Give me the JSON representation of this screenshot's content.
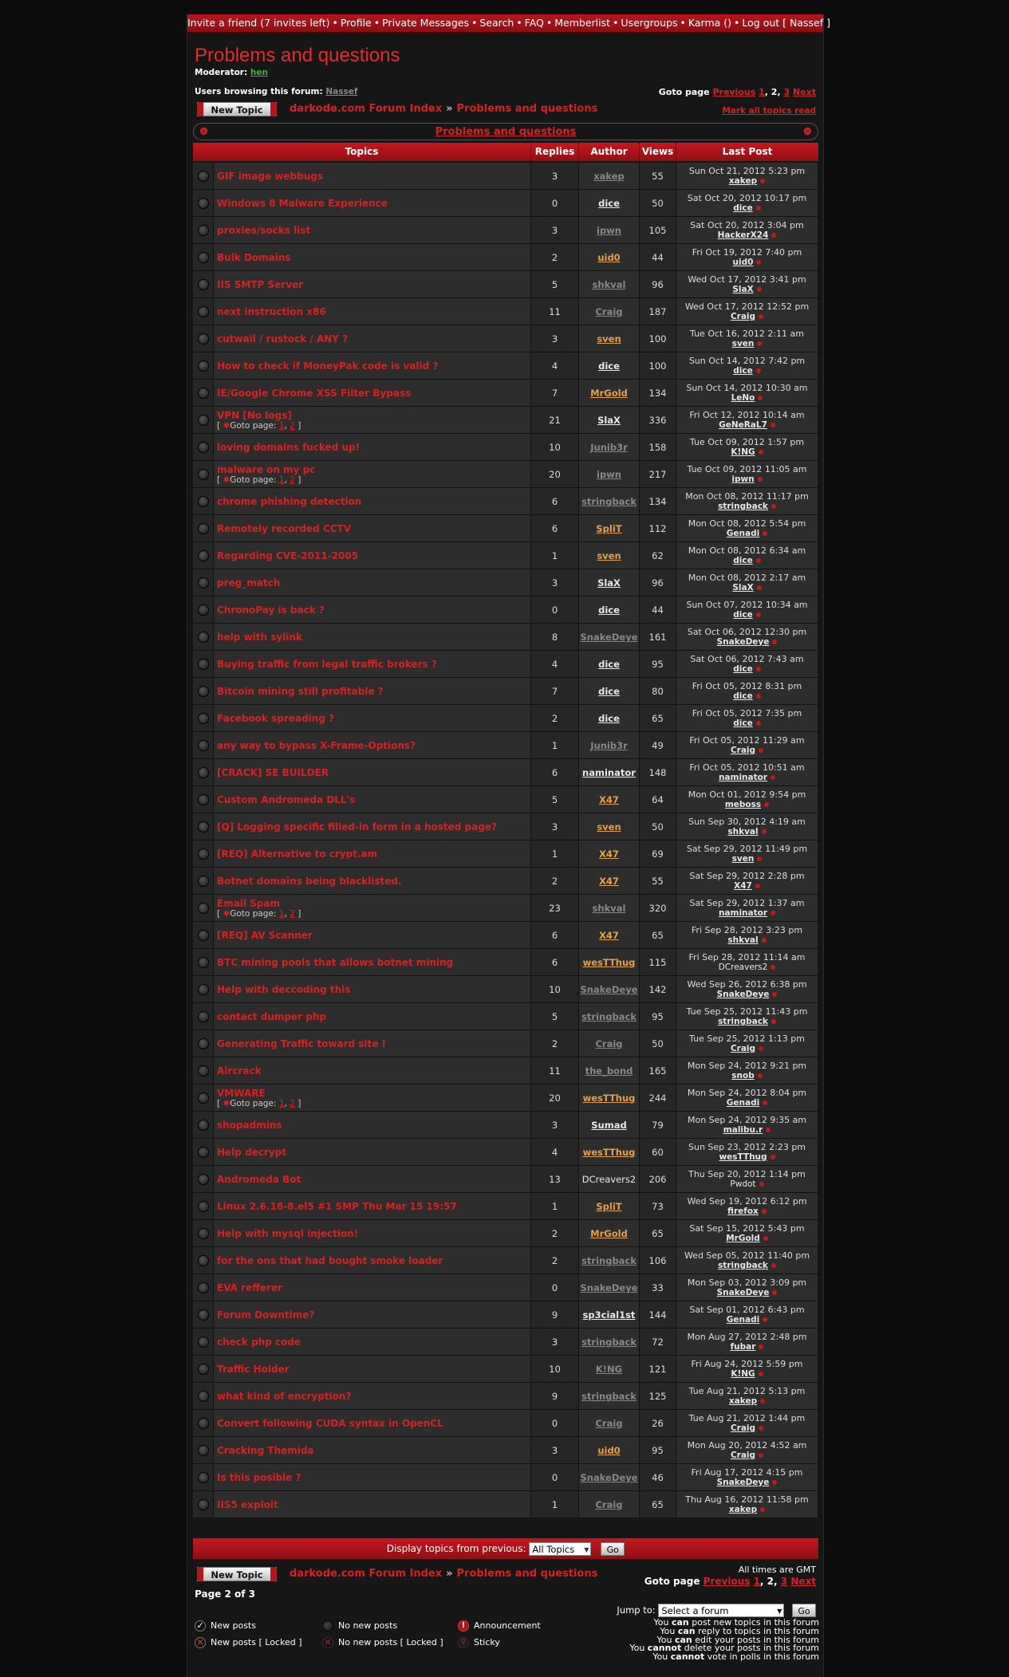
{
  "nav": {
    "items": [
      "Invite a friend (7 invites left)",
      "Profile",
      "Private Messages",
      "Search",
      "FAQ",
      "Memberlist",
      "Usergroups",
      "Karma ()",
      "Log out [ Nassef ]"
    ]
  },
  "forum": {
    "title": "Problems and questions",
    "moderator_label": "Moderator:",
    "moderator": "hen",
    "browsing_label": "Users browsing this forum:",
    "browsing_user": "Nassef",
    "mark_all": "Mark all topics read",
    "new_topic": "New Topic",
    "crumb_index": "darkode.com Forum Index",
    "crumb_sep": "»",
    "crumb_forum": "Problems and questions",
    "category_title": "Problems and questions"
  },
  "pagination": {
    "label": "Goto page",
    "previous": "Previous",
    "p1": "1",
    "p2": "2",
    "p3": "3",
    "next": "Next",
    "page_of": "Page 2 of 3"
  },
  "table": {
    "headers": [
      "Topics",
      "Replies",
      "Author",
      "Views",
      "Last Post"
    ]
  },
  "topics": [
    {
      "title": "GIF image webbugs",
      "replies": "3",
      "author": "xakep",
      "author_style": "gray",
      "views": "55",
      "last_date": "Sun Oct 21, 2012 5:23 pm",
      "last_user": "xakep",
      "last_style": "white"
    },
    {
      "title": "Windows 8 Malware Experience",
      "replies": "0",
      "author": "dice",
      "author_style": "white",
      "views": "50",
      "last_date": "Sat Oct 20, 2012 10:17 pm",
      "last_user": "dice",
      "last_style": "white"
    },
    {
      "title": "proxies/socks list",
      "replies": "3",
      "author": "ipwn",
      "author_style": "gray",
      "views": "105",
      "last_date": "Sat Oct 20, 2012 3:04 pm",
      "last_user": "HackerX24",
      "last_style": "white"
    },
    {
      "title": "Bulk Domains",
      "replies": "2",
      "author": "uid0",
      "author_style": "orange",
      "views": "44",
      "last_date": "Fri Oct 19, 2012 7:40 pm",
      "last_user": "uid0",
      "last_style": "white"
    },
    {
      "title": "IIS SMTP Server",
      "replies": "5",
      "author": "shkval",
      "author_style": "gray",
      "views": "96",
      "last_date": "Wed Oct 17, 2012 3:41 pm",
      "last_user": "SlaX",
      "last_style": "white"
    },
    {
      "title": "next instruction x86",
      "replies": "11",
      "author": "Craig",
      "author_style": "gray",
      "views": "187",
      "last_date": "Wed Oct 17, 2012 12:52 pm",
      "last_user": "Craig",
      "last_style": "white"
    },
    {
      "title": "cutwail / rustock / ANY ?",
      "replies": "3",
      "author": "sven",
      "author_style": "orange",
      "views": "100",
      "last_date": "Tue Oct 16, 2012 2:11 am",
      "last_user": "sven",
      "last_style": "white"
    },
    {
      "title": "How to check if MoneyPak code is valid ?",
      "replies": "4",
      "author": "dice",
      "author_style": "white",
      "views": "100",
      "last_date": "Sun Oct 14, 2012 7:42 pm",
      "last_user": "dice",
      "last_style": "white"
    },
    {
      "title": "IE/Google Chrome XSS Filter Bypass",
      "replies": "7",
      "author": "MrGold",
      "author_style": "orange",
      "views": "134",
      "last_date": "Sun Oct 14, 2012 10:30 am",
      "last_user": "LeNo",
      "last_style": "white"
    },
    {
      "title": "VPN [No logs]",
      "pages": true,
      "replies": "21",
      "author": "SlaX",
      "author_style": "white",
      "views": "336",
      "last_date": "Fri Oct 12, 2012 10:14 am",
      "last_user": "GeNeRaL7",
      "last_style": "white"
    },
    {
      "title": "loving domains fucked up!",
      "replies": "10",
      "author": "Junib3r",
      "author_style": "gray",
      "views": "158",
      "last_date": "Tue Oct 09, 2012 1:57 pm",
      "last_user": "K!NG",
      "last_style": "white"
    },
    {
      "title": "malware on my pc",
      "pages": true,
      "replies": "20",
      "author": "ipwn",
      "author_style": "gray",
      "views": "217",
      "last_date": "Tue Oct 09, 2012 11:05 am",
      "last_user": "ipwn",
      "last_style": "white"
    },
    {
      "title": "chrome phishing detection",
      "replies": "6",
      "author": "stringback",
      "author_style": "gray",
      "views": "134",
      "last_date": "Mon Oct 08, 2012 11:17 pm",
      "last_user": "stringback",
      "last_style": "white"
    },
    {
      "title": "Remotely recorded CCTV",
      "replies": "6",
      "author": "SpliT",
      "author_style": "orange",
      "views": "112",
      "last_date": "Mon Oct 08, 2012 5:54 pm",
      "last_user": "Genadi",
      "last_style": "white"
    },
    {
      "title": "Regarding CVE-2011-2005",
      "replies": "1",
      "author": "sven",
      "author_style": "orange",
      "views": "62",
      "last_date": "Mon Oct 08, 2012 6:34 am",
      "last_user": "dice",
      "last_style": "white"
    },
    {
      "title": "preg_match",
      "replies": "3",
      "author": "SlaX",
      "author_style": "white",
      "views": "96",
      "last_date": "Mon Oct 08, 2012 2:17 am",
      "last_user": "SlaX",
      "last_style": "white"
    },
    {
      "title": "ChronoPay is back ?",
      "replies": "0",
      "author": "dice",
      "author_style": "white",
      "views": "44",
      "last_date": "Sun Oct 07, 2012 10:34 am",
      "last_user": "dice",
      "last_style": "white"
    },
    {
      "title": "help with sylink",
      "replies": "8",
      "author": "SnakeDeye",
      "author_style": "gray",
      "views": "161",
      "last_date": "Sat Oct 06, 2012 12:30 pm",
      "last_user": "SnakeDeye",
      "last_style": "white"
    },
    {
      "title": "Buying traffic from legal traffic brokers ?",
      "replies": "4",
      "author": "dice",
      "author_style": "white",
      "views": "95",
      "last_date": "Sat Oct 06, 2012 7:43 am",
      "last_user": "dice",
      "last_style": "white"
    },
    {
      "title": "Bitcoin mining still profitable ?",
      "replies": "7",
      "author": "dice",
      "author_style": "white",
      "views": "80",
      "last_date": "Fri Oct 05, 2012 8:31 pm",
      "last_user": "dice",
      "last_style": "white"
    },
    {
      "title": "Facebook spreading ?",
      "replies": "2",
      "author": "dice",
      "author_style": "white",
      "views": "65",
      "last_date": "Fri Oct 05, 2012 7:35 pm",
      "last_user": "dice",
      "last_style": "white"
    },
    {
      "title": "any way to bypass X-Frame-Options?",
      "replies": "1",
      "author": "Junib3r",
      "author_style": "gray",
      "views": "49",
      "last_date": "Fri Oct 05, 2012 11:29 am",
      "last_user": "Craig",
      "last_style": "white"
    },
    {
      "title": "[CRACK] SE BUILDER",
      "replies": "6",
      "author": "naminator",
      "author_style": "white",
      "views": "148",
      "last_date": "Fri Oct 05, 2012 10:51 am",
      "last_user": "naminator",
      "last_style": "white"
    },
    {
      "title": "Custom Andromeda DLL's",
      "replies": "5",
      "author": "X47",
      "author_style": "orange",
      "views": "64",
      "last_date": "Mon Oct 01, 2012 9:54 pm",
      "last_user": "meboss",
      "last_style": "white"
    },
    {
      "title": "[Q] Logging specific filled-in form in a hosted page?",
      "replies": "3",
      "author": "sven",
      "author_style": "orange",
      "views": "50",
      "last_date": "Sun Sep 30, 2012 4:19 am",
      "last_user": "shkval",
      "last_style": "white"
    },
    {
      "title": "[REQ] Alternative to crypt.am",
      "replies": "1",
      "author": "X47",
      "author_style": "orange",
      "views": "69",
      "last_date": "Sat Sep 29, 2012 11:49 pm",
      "last_user": "sven",
      "last_style": "white"
    },
    {
      "title": "Botnet domains being blacklisted.",
      "replies": "2",
      "author": "X47",
      "author_style": "orange",
      "views": "55",
      "last_date": "Sat Sep 29, 2012 2:28 pm",
      "last_user": "X47",
      "last_style": "white"
    },
    {
      "title": "Email Spam",
      "pages": true,
      "replies": "23",
      "author": "shkval",
      "author_style": "gray",
      "views": "320",
      "last_date": "Sat Sep 29, 2012 1:37 am",
      "last_user": "naminator",
      "last_style": "white"
    },
    {
      "title": "[REQ] AV Scanner",
      "replies": "6",
      "author": "X47",
      "author_style": "orange",
      "views": "65",
      "last_date": "Fri Sep 28, 2012 3:23 pm",
      "last_user": "shkval",
      "last_style": "white"
    },
    {
      "title": "BTC mining pools that allows botnet mining",
      "replies": "6",
      "author": "wesTThug",
      "author_style": "orange",
      "views": "115",
      "last_date": "Fri Sep 28, 2012 11:14 am",
      "last_user": "DCreavers2",
      "last_style": "plain"
    },
    {
      "title": "Help with deccoding this",
      "replies": "10",
      "author": "SnakeDeye",
      "author_style": "gray",
      "views": "142",
      "last_date": "Wed Sep 26, 2012 6:38 pm",
      "last_user": "SnakeDeye",
      "last_style": "white"
    },
    {
      "title": "contact dumper php",
      "replies": "5",
      "author": "stringback",
      "author_style": "gray",
      "views": "95",
      "last_date": "Tue Sep 25, 2012 11:43 pm",
      "last_user": "stringback",
      "last_style": "white"
    },
    {
      "title": "Generating Traffic toward site !",
      "replies": "2",
      "author": "Craig",
      "author_style": "gray",
      "views": "50",
      "last_date": "Tue Sep 25, 2012 1:13 pm",
      "last_user": "Craig",
      "last_style": "white"
    },
    {
      "title": "Aircrack",
      "replies": "11",
      "author": "the_bond",
      "author_style": "gray",
      "views": "165",
      "last_date": "Mon Sep 24, 2012 9:21 pm",
      "last_user": "snob",
      "last_style": "white"
    },
    {
      "title": "VMWARE",
      "pages": true,
      "replies": "20",
      "author": "wesTThug",
      "author_style": "orange",
      "views": "244",
      "last_date": "Mon Sep 24, 2012 8:04 pm",
      "last_user": "Genadi",
      "last_style": "white"
    },
    {
      "title": "shopadmins",
      "replies": "3",
      "author": "Sumad",
      "author_style": "white",
      "views": "79",
      "last_date": "Mon Sep 24, 2012 9:35 am",
      "last_user": "malibu.r",
      "last_style": "white"
    },
    {
      "title": "Help decrypt",
      "replies": "4",
      "author": "wesTThug",
      "author_style": "orange",
      "views": "60",
      "last_date": "Sun Sep 23, 2012 2:23 pm",
      "last_user": "wesTThug",
      "last_style": "white"
    },
    {
      "title": "Andromeda Bot",
      "replies": "13",
      "author": "DCreavers2",
      "author_style": "plain",
      "views": "206",
      "last_date": "Thu Sep 20, 2012 1:14 pm",
      "last_user": "Pwdot",
      "last_style": "plain"
    },
    {
      "title": "Linux 2.6.18-8.el5 #1 SMP Thu Mar 15 19:57",
      "replies": "1",
      "author": "SpliT",
      "author_style": "orange",
      "views": "73",
      "last_date": "Wed Sep 19, 2012 6:12 pm",
      "last_user": "firefox",
      "last_style": "white"
    },
    {
      "title": "Help with mysql injection!",
      "replies": "2",
      "author": "MrGold",
      "author_style": "orange",
      "views": "65",
      "last_date": "Sat Sep 15, 2012 5:43 pm",
      "last_user": "MrGold",
      "last_style": "white"
    },
    {
      "title": "for the ons that had bought smoke loader",
      "replies": "2",
      "author": "stringback",
      "author_style": "gray",
      "views": "106",
      "last_date": "Wed Sep 05, 2012 11:40 pm",
      "last_user": "stringback",
      "last_style": "white"
    },
    {
      "title": "EVA refferer",
      "replies": "0",
      "author": "SnakeDeye",
      "author_style": "gray",
      "views": "33",
      "last_date": "Mon Sep 03, 2012 3:09 pm",
      "last_user": "SnakeDeye",
      "last_style": "white"
    },
    {
      "title": "Forum Downtime?",
      "replies": "9",
      "author": "sp3cial1st",
      "author_style": "white",
      "views": "144",
      "last_date": "Sat Sep 01, 2012 6:43 pm",
      "last_user": "Genadi",
      "last_style": "white"
    },
    {
      "title": "check php code",
      "replies": "3",
      "author": "stringback",
      "author_style": "gray",
      "views": "72",
      "last_date": "Mon Aug 27, 2012 2:48 pm",
      "last_user": "fubar",
      "last_style": "white"
    },
    {
      "title": "Traffic Holder",
      "replies": "10",
      "author": "K!NG",
      "author_style": "gray",
      "views": "121",
      "last_date": "Fri Aug 24, 2012 5:59 pm",
      "last_user": "K!NG",
      "last_style": "white"
    },
    {
      "title": "what kind of encryption?",
      "replies": "9",
      "author": "stringback",
      "author_style": "gray",
      "views": "125",
      "last_date": "Tue Aug 21, 2012 5:13 pm",
      "last_user": "xakep",
      "last_style": "white"
    },
    {
      "title": "Convert following CUDA syntax in OpenCL",
      "replies": "0",
      "author": "Craig",
      "author_style": "gray",
      "views": "26",
      "last_date": "Tue Aug 21, 2012 1:44 pm",
      "last_user": "Craig",
      "last_style": "white"
    },
    {
      "title": "Cracking Themida",
      "replies": "3",
      "author": "uid0",
      "author_style": "orange",
      "views": "95",
      "last_date": "Mon Aug 20, 2012 4:52 am",
      "last_user": "Craig",
      "last_style": "white"
    },
    {
      "title": "Is this posible ?",
      "replies": "0",
      "author": "SnakeDeye",
      "author_style": "gray",
      "views": "46",
      "last_date": "Fri Aug 17, 2012 4:15 pm",
      "last_user": "SnakeDeye",
      "last_style": "white"
    },
    {
      "title": "IIS5 exploit",
      "replies": "1",
      "author": "Craig",
      "author_style": "gray",
      "views": "65",
      "last_date": "Thu Aug 16, 2012 11:58 pm",
      "last_user": "xakep",
      "last_style": "white"
    }
  ],
  "topic_pages": {
    "open": "[",
    "label": "Goto page:",
    "p1": "1",
    "comma": ",",
    "p2": "2",
    "close": "]"
  },
  "filter": {
    "label": "Display topics from previous:",
    "value": "All Topics",
    "go": "Go"
  },
  "footer": {
    "timezone": "All times are GMT",
    "jump_label": "Jump to:",
    "jump_value": "Select a forum",
    "jump_go": "Go"
  },
  "legend": {
    "new_posts": "New posts",
    "no_new_posts": "No new posts",
    "announcement": "Announcement",
    "new_posts_locked": "New posts [ Locked ]",
    "no_new_posts_locked": "No new posts [ Locked ]",
    "sticky": "Sticky"
  },
  "permissions": [
    {
      "pre": "You ",
      "verb": "can",
      "post": " post new topics in this forum"
    },
    {
      "pre": "You ",
      "verb": "can",
      "post": " reply to topics in this forum"
    },
    {
      "pre": "You ",
      "verb": "can",
      "post": " edit your posts in this forum"
    },
    {
      "pre": "You ",
      "verb": "cannot",
      "post": " delete your posts in this forum"
    },
    {
      "pre": "You ",
      "verb": "cannot",
      "post": " vote in polls in this forum"
    }
  ],
  "colors": {
    "accent_red": "#d42222",
    "header_red": "#c5171d",
    "author_orange": "#e5a04a",
    "author_gray": "#888888",
    "moderator_green": "#3fae3f"
  }
}
